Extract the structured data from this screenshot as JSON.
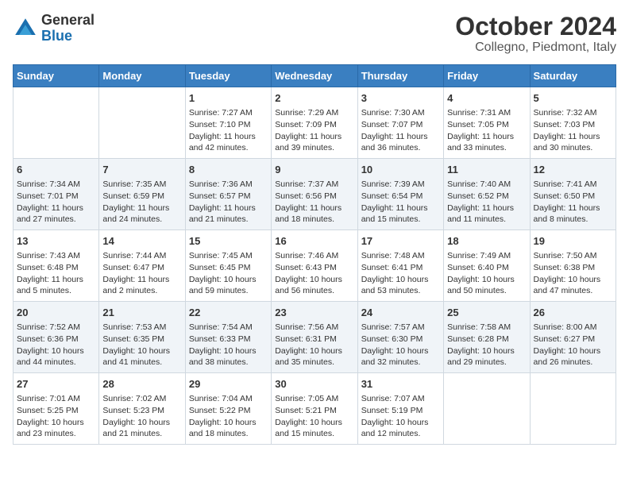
{
  "logo": {
    "general": "General",
    "blue": "Blue"
  },
  "title": "October 2024",
  "subtitle": "Collegno, Piedmont, Italy",
  "headers": [
    "Sunday",
    "Monday",
    "Tuesday",
    "Wednesday",
    "Thursday",
    "Friday",
    "Saturday"
  ],
  "weeks": [
    [
      {
        "day": "",
        "info": ""
      },
      {
        "day": "",
        "info": ""
      },
      {
        "day": "1",
        "info": "Sunrise: 7:27 AM\nSunset: 7:10 PM\nDaylight: 11 hours and 42 minutes."
      },
      {
        "day": "2",
        "info": "Sunrise: 7:29 AM\nSunset: 7:09 PM\nDaylight: 11 hours and 39 minutes."
      },
      {
        "day": "3",
        "info": "Sunrise: 7:30 AM\nSunset: 7:07 PM\nDaylight: 11 hours and 36 minutes."
      },
      {
        "day": "4",
        "info": "Sunrise: 7:31 AM\nSunset: 7:05 PM\nDaylight: 11 hours and 33 minutes."
      },
      {
        "day": "5",
        "info": "Sunrise: 7:32 AM\nSunset: 7:03 PM\nDaylight: 11 hours and 30 minutes."
      }
    ],
    [
      {
        "day": "6",
        "info": "Sunrise: 7:34 AM\nSunset: 7:01 PM\nDaylight: 11 hours and 27 minutes."
      },
      {
        "day": "7",
        "info": "Sunrise: 7:35 AM\nSunset: 6:59 PM\nDaylight: 11 hours and 24 minutes."
      },
      {
        "day": "8",
        "info": "Sunrise: 7:36 AM\nSunset: 6:57 PM\nDaylight: 11 hours and 21 minutes."
      },
      {
        "day": "9",
        "info": "Sunrise: 7:37 AM\nSunset: 6:56 PM\nDaylight: 11 hours and 18 minutes."
      },
      {
        "day": "10",
        "info": "Sunrise: 7:39 AM\nSunset: 6:54 PM\nDaylight: 11 hours and 15 minutes."
      },
      {
        "day": "11",
        "info": "Sunrise: 7:40 AM\nSunset: 6:52 PM\nDaylight: 11 hours and 11 minutes."
      },
      {
        "day": "12",
        "info": "Sunrise: 7:41 AM\nSunset: 6:50 PM\nDaylight: 11 hours and 8 minutes."
      }
    ],
    [
      {
        "day": "13",
        "info": "Sunrise: 7:43 AM\nSunset: 6:48 PM\nDaylight: 11 hours and 5 minutes."
      },
      {
        "day": "14",
        "info": "Sunrise: 7:44 AM\nSunset: 6:47 PM\nDaylight: 11 hours and 2 minutes."
      },
      {
        "day": "15",
        "info": "Sunrise: 7:45 AM\nSunset: 6:45 PM\nDaylight: 10 hours and 59 minutes."
      },
      {
        "day": "16",
        "info": "Sunrise: 7:46 AM\nSunset: 6:43 PM\nDaylight: 10 hours and 56 minutes."
      },
      {
        "day": "17",
        "info": "Sunrise: 7:48 AM\nSunset: 6:41 PM\nDaylight: 10 hours and 53 minutes."
      },
      {
        "day": "18",
        "info": "Sunrise: 7:49 AM\nSunset: 6:40 PM\nDaylight: 10 hours and 50 minutes."
      },
      {
        "day": "19",
        "info": "Sunrise: 7:50 AM\nSunset: 6:38 PM\nDaylight: 10 hours and 47 minutes."
      }
    ],
    [
      {
        "day": "20",
        "info": "Sunrise: 7:52 AM\nSunset: 6:36 PM\nDaylight: 10 hours and 44 minutes."
      },
      {
        "day": "21",
        "info": "Sunrise: 7:53 AM\nSunset: 6:35 PM\nDaylight: 10 hours and 41 minutes."
      },
      {
        "day": "22",
        "info": "Sunrise: 7:54 AM\nSunset: 6:33 PM\nDaylight: 10 hours and 38 minutes."
      },
      {
        "day": "23",
        "info": "Sunrise: 7:56 AM\nSunset: 6:31 PM\nDaylight: 10 hours and 35 minutes."
      },
      {
        "day": "24",
        "info": "Sunrise: 7:57 AM\nSunset: 6:30 PM\nDaylight: 10 hours and 32 minutes."
      },
      {
        "day": "25",
        "info": "Sunrise: 7:58 AM\nSunset: 6:28 PM\nDaylight: 10 hours and 29 minutes."
      },
      {
        "day": "26",
        "info": "Sunrise: 8:00 AM\nSunset: 6:27 PM\nDaylight: 10 hours and 26 minutes."
      }
    ],
    [
      {
        "day": "27",
        "info": "Sunrise: 7:01 AM\nSunset: 5:25 PM\nDaylight: 10 hours and 23 minutes."
      },
      {
        "day": "28",
        "info": "Sunrise: 7:02 AM\nSunset: 5:23 PM\nDaylight: 10 hours and 21 minutes."
      },
      {
        "day": "29",
        "info": "Sunrise: 7:04 AM\nSunset: 5:22 PM\nDaylight: 10 hours and 18 minutes."
      },
      {
        "day": "30",
        "info": "Sunrise: 7:05 AM\nSunset: 5:21 PM\nDaylight: 10 hours and 15 minutes."
      },
      {
        "day": "31",
        "info": "Sunrise: 7:07 AM\nSunset: 5:19 PM\nDaylight: 10 hours and 12 minutes."
      },
      {
        "day": "",
        "info": ""
      },
      {
        "day": "",
        "info": ""
      }
    ]
  ]
}
